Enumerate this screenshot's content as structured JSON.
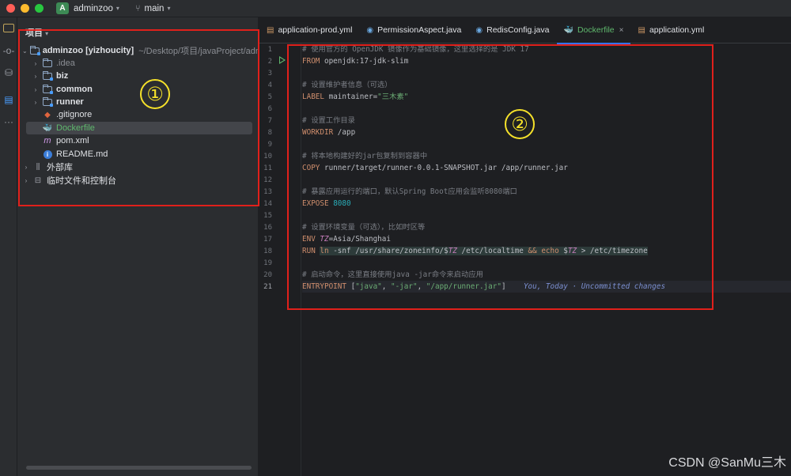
{
  "titlebar": {
    "project_badge": "A",
    "project_name": "adminzoo",
    "branch": "main"
  },
  "project_panel": {
    "header": "项目",
    "root": {
      "name": "adminzoo [yizhoucity]",
      "path": "~/Desktop/项目/javaProject/adminzoo",
      "suffix": "ma"
    },
    "items": [
      {
        "label": ".idea",
        "type": "folder"
      },
      {
        "label": "biz",
        "type": "module"
      },
      {
        "label": "common",
        "type": "module"
      },
      {
        "label": "runner",
        "type": "module"
      },
      {
        "label": ".gitignore",
        "type": "git"
      },
      {
        "label": "Dockerfile",
        "type": "docker"
      },
      {
        "label": "pom.xml",
        "type": "xml"
      },
      {
        "label": "README.md",
        "type": "md"
      }
    ],
    "external_libs": "外部库",
    "scratches": "临时文件和控制台"
  },
  "tabs": [
    {
      "label": "application-prod.yml",
      "icon": "yml-icon"
    },
    {
      "label": "PermissionAspect.java",
      "icon": "java-icon"
    },
    {
      "label": "RedisConfig.java",
      "icon": "java-icon"
    },
    {
      "label": "Dockerfile",
      "icon": "docker-icon",
      "active": true
    },
    {
      "label": "application.yml",
      "icon": "yml-icon"
    }
  ],
  "code": {
    "line_numbers": [
      "1",
      "2",
      "3",
      "4",
      "5",
      "6",
      "7",
      "8",
      "9",
      "10",
      "11",
      "12",
      "13",
      "14",
      "15",
      "16",
      "17",
      "18",
      "19",
      "20",
      "21"
    ],
    "l1": "# 使用官方的 OpenJDK 镜像作为基础镜像，这里选择的是 JDK 17",
    "l2_kw": "FROM",
    "l2_rest": " openjdk:17-jdk-slim",
    "l4": "# 设置维护者信息（可选）",
    "l5_kw": "LABEL",
    "l5_rest": " maintainer=",
    "l5_str": "\"三木素\"",
    "l7": "# 设置工作目录",
    "l8_kw": "WORKDIR",
    "l8_rest": " /app",
    "l10": "# 将本地构建好的jar包复制到容器中",
    "l11_kw": "COPY",
    "l11_rest": " runner/target/runner-0.0.1-SNAPSHOT.jar /app/runner.jar",
    "l13": "# 暴露应用运行的端口，默认Spring Boot应用会监听8080端口",
    "l14_kw": "EXPOSE",
    "l14_num": "8080",
    "l16": "# 设置环境变量（可选），比如时区等",
    "l17_kw": "ENV",
    "l17_var": "TZ",
    "l17_rest": "=Asia/Shanghai",
    "l18_kw": "RUN",
    "l18_ln": "ln",
    "l18_a": " -snf /usr/share/zoneinfo/$",
    "l18_var1": "TZ",
    "l18_b": " /etc/localtime ",
    "l18_and": "&&",
    "l18_echo": "echo",
    "l18_c": " $",
    "l18_var2": "TZ",
    "l18_d": " > /etc/timezone",
    "l20": "# 启动命令，这里直接使用java -jar命令来启动应用",
    "l21_kw": "ENTRYPOINT",
    "l21_a": " [",
    "l21_s1": "\"java\"",
    "l21_c1": ", ",
    "l21_s2": "\"-jar\"",
    "l21_c2": ", ",
    "l21_s3": "\"/app/runner.jar\"",
    "l21_b": "]",
    "blame": "You, Today · Uncommitted changes"
  },
  "annotations": {
    "one": "①",
    "two": "②"
  },
  "watermark": "CSDN @SanMu三木",
  "colors": {
    "annotation_box": "#e0201b",
    "annotation_number": "#f5e12a",
    "active_tab": "#5fb86d"
  }
}
